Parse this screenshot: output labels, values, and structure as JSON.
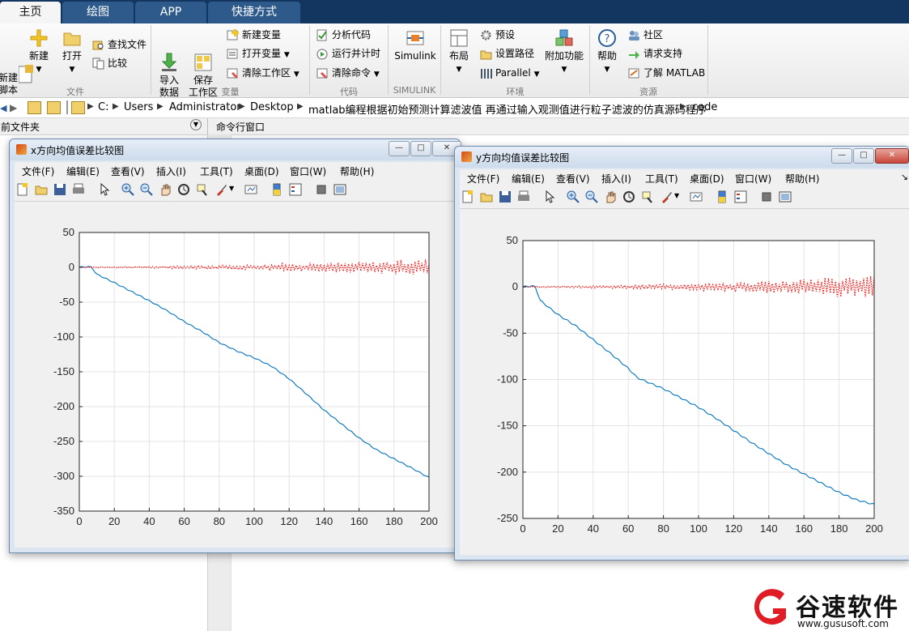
{
  "tabs": [
    {
      "label": "主页",
      "active": true
    },
    {
      "label": "绘图",
      "active": false
    },
    {
      "label": "APP",
      "active": false
    },
    {
      "label": "快捷方式",
      "active": false
    }
  ],
  "ribbon": {
    "file": {
      "new_script": "新建\n脚本",
      "new": "新建",
      "open": "打开",
      "find_files": "查找文件",
      "compare": "比较",
      "group": "文件"
    },
    "variable": {
      "import": "导入\n数据",
      "save_ws": "保存\n工作区",
      "new_var": "新建变量",
      "open_var": "打开变量",
      "clear_ws": "清除工作区",
      "group": "变量"
    },
    "code": {
      "analyze": "分析代码",
      "run_time": "运行并计时",
      "clear_cmd": "清除命令",
      "group": "代码"
    },
    "simulink": {
      "label": "Simulink",
      "group": "SIMULINK"
    },
    "env": {
      "layout": "布局",
      "prefs": "预设",
      "set_path": "设置路径",
      "parallel": "Parallel",
      "addons": "附加功能",
      "group": "环境"
    },
    "resources": {
      "help": "帮助",
      "community": "社区",
      "support": "请求支持",
      "learn": "了解 MATLAB",
      "group": "资源"
    }
  },
  "address": {
    "crumbs": [
      "C:",
      "Users",
      "Administrator",
      "Desktop",
      "matlab编程根据初始预测计算滤波值 再通过输入观测值进行粒子滤波的仿真源码程序",
      "code"
    ]
  },
  "panels": {
    "current_folder": "当前文件夹",
    "command_window": "命令行窗口"
  },
  "fig_menu": [
    "文件(F)",
    "编辑(E)",
    "查看(V)",
    "插入(I)",
    "工具(T)",
    "桌面(D)",
    "窗口(W)",
    "帮助(H)"
  ],
  "colors": {
    "blue_series": "#0072bd",
    "red_series": "#ff0000",
    "tab_bar": "#12365f"
  },
  "figures": [
    {
      "title": "x方向均值误差比较图"
    },
    {
      "title": "y方向均值误差比较图"
    }
  ],
  "chart_data": [
    {
      "type": "line",
      "title": "",
      "xlabel": "",
      "ylabel": "",
      "xlim": [
        0,
        200
      ],
      "ylim": [
        -350,
        50
      ],
      "xticks": [
        0,
        20,
        40,
        60,
        80,
        100,
        120,
        140,
        160,
        180,
        200
      ],
      "yticks": [
        50,
        0,
        -50,
        -100,
        -150,
        -200,
        -250,
        -300,
        -350
      ],
      "grid": true,
      "series": [
        {
          "style": "solid",
          "color": "#0072bd",
          "x": [
            0,
            5,
            7,
            10,
            20,
            30,
            40,
            50,
            60,
            70,
            80,
            90,
            100,
            110,
            120,
            130,
            140,
            150,
            160,
            170,
            180,
            190,
            200
          ],
          "y": [
            0,
            1,
            0,
            -10,
            -22,
            -35,
            -48,
            -62,
            -78,
            -92,
            -108,
            -120,
            -130,
            -142,
            -160,
            -182,
            -205,
            -225,
            -245,
            -262,
            -275,
            -288,
            -302
          ]
        },
        {
          "style": "dotted",
          "color": "#ff0000",
          "noise": true,
          "x": [
            0,
            20,
            40,
            60,
            80,
            100,
            120,
            140,
            160,
            180,
            200
          ],
          "y": [
            0,
            0,
            0,
            0,
            0,
            0,
            0,
            0,
            0,
            0,
            0
          ],
          "amplitude": [
            0.5,
            1,
            1.5,
            2.5,
            3,
            4,
            6,
            7,
            8,
            10,
            13
          ]
        }
      ]
    },
    {
      "type": "line",
      "title": "",
      "xlabel": "",
      "ylabel": "",
      "xlim": [
        0,
        200
      ],
      "ylim": [
        -250,
        50
      ],
      "xticks": [
        0,
        20,
        40,
        60,
        80,
        100,
        120,
        140,
        160,
        180,
        200
      ],
      "yticks": [
        50,
        0,
        -50,
        -100,
        -150,
        -200,
        -250
      ],
      "grid": true,
      "series": [
        {
          "style": "solid",
          "color": "#0072bd",
          "x": [
            0,
            5,
            7,
            10,
            20,
            30,
            40,
            50,
            60,
            65,
            70,
            80,
            90,
            100,
            110,
            120,
            130,
            140,
            150,
            160,
            170,
            180,
            190,
            200
          ],
          "y": [
            0,
            1,
            0,
            -15,
            -30,
            -42,
            -57,
            -72,
            -88,
            -98,
            -102,
            -110,
            -120,
            -130,
            -142,
            -155,
            -168,
            -180,
            -192,
            -202,
            -212,
            -222,
            -230,
            -235
          ]
        },
        {
          "style": "dotted",
          "color": "#ff0000",
          "noise": true,
          "x": [
            0,
            20,
            40,
            60,
            80,
            100,
            120,
            140,
            160,
            180,
            200
          ],
          "y": [
            0,
            0,
            0,
            0,
            0,
            0,
            0,
            0,
            0,
            0,
            0
          ],
          "amplitude": [
            0.5,
            1,
            1.5,
            2.5,
            3,
            4,
            5.5,
            7,
            9,
            11,
            13
          ]
        }
      ]
    }
  ],
  "watermark": {
    "brand": "谷速软件",
    "url": "www.gususoft.com"
  }
}
